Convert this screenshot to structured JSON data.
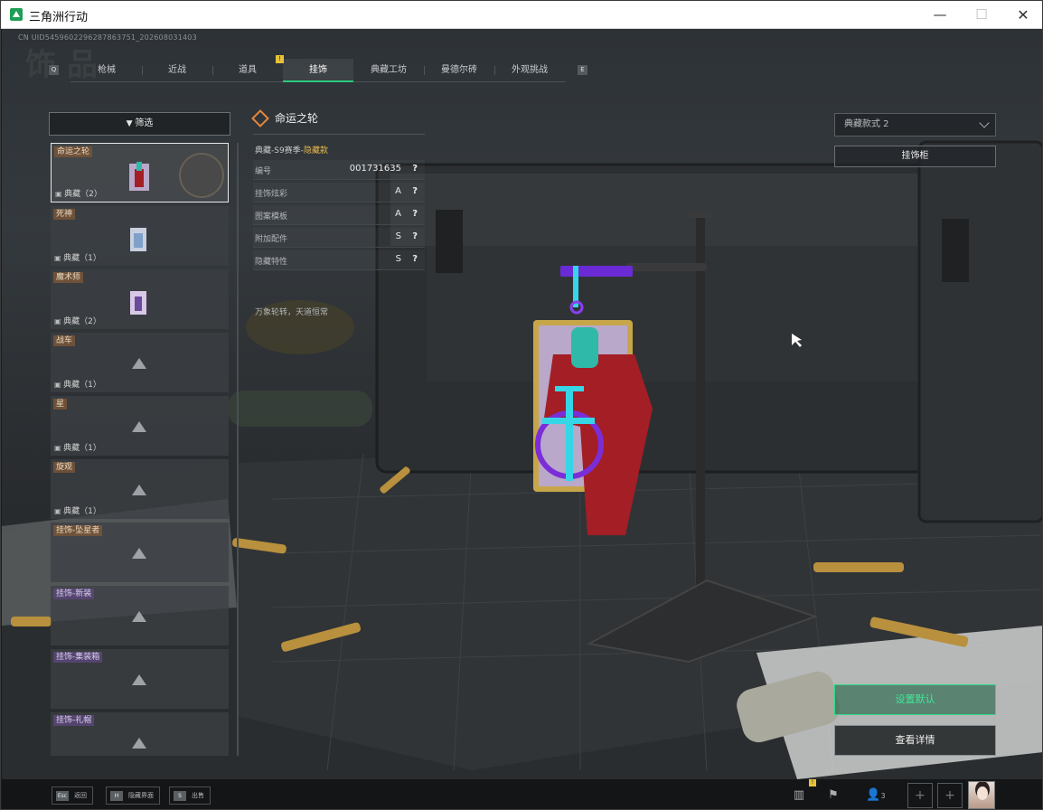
{
  "window": {
    "title": "三角洲行动",
    "minimize": "—",
    "maximize": "☐",
    "close": "✕"
  },
  "header": {
    "uid": "CN UID5459602296287863751_202608031403",
    "page_title": "饰 品"
  },
  "tabs": {
    "left_key": "Q",
    "right_key": "E",
    "badge": "!",
    "items": [
      "枪械",
      "近战",
      "道具",
      "挂饰",
      "典藏工坊",
      "曼德尔砖",
      "外观挑战"
    ],
    "active_index": 3
  },
  "filter": {
    "label": "筛选",
    "icon": "filter-icon"
  },
  "list": [
    {
      "name": "命运之轮",
      "meta": "典藏（2）",
      "locked": false,
      "tag_color": "brown"
    },
    {
      "name": "死神",
      "meta": "典藏（1）",
      "locked": false,
      "tag_color": "brown"
    },
    {
      "name": "魔术师",
      "meta": "典藏（2）",
      "locked": false,
      "tag_color": "brown"
    },
    {
      "name": "战车",
      "meta": "典藏（1）",
      "locked": true,
      "tag_color": "brown"
    },
    {
      "name": "星",
      "meta": "典藏（1）",
      "locked": true,
      "tag_color": "brown"
    },
    {
      "name": "旋观",
      "meta": "典藏（1）",
      "locked": true,
      "tag_color": "brown"
    },
    {
      "name": "挂饰-坠星者",
      "meta": "",
      "locked": true,
      "tag_color": "brown"
    },
    {
      "name": "挂饰-新装",
      "meta": "",
      "locked": true,
      "tag_color": "purple"
    },
    {
      "name": "挂饰-集装箱",
      "meta": "",
      "locked": true,
      "tag_color": "purple"
    },
    {
      "name": "挂饰-礼帽",
      "meta": "",
      "locked": true,
      "tag_color": "purple"
    }
  ],
  "detail": {
    "title": "命运之轮",
    "season_prefix": "典藏-S9赛季-",
    "season_highlight": "隐藏款",
    "rows": [
      {
        "key": "编号",
        "value": "001731635",
        "q": "?"
      },
      {
        "key": "挂饰炫彩",
        "value": "A",
        "q": "?"
      },
      {
        "key": "图案模板",
        "value": "A",
        "q": "?"
      },
      {
        "key": "附加配件",
        "value": "S",
        "q": "?"
      },
      {
        "key": "隐藏特性",
        "value": "S",
        "q": "?"
      }
    ],
    "description": "万象轮转，天道恒常"
  },
  "right": {
    "dropdown_value": "典藏款式 2",
    "cabinet_label": "挂饰柜",
    "set_default_label": "设置默认",
    "view_detail_label": "查看详情"
  },
  "bottom": {
    "hints": [
      {
        "key": "Esc",
        "label": "返回"
      },
      {
        "key": "H",
        "label": "隐藏界面"
      },
      {
        "key": "S",
        "label": "出售"
      }
    ],
    "friends_count": "3",
    "badge": "!",
    "add": "+"
  }
}
